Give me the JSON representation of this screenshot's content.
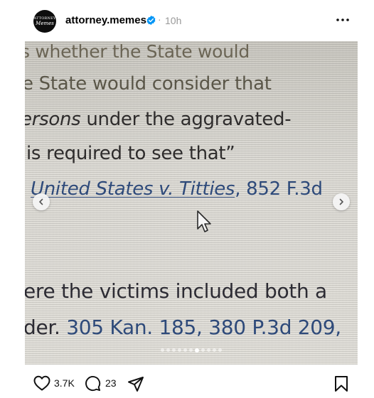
{
  "post": {
    "username": "attorney.memes",
    "separator": "·",
    "time": "10h",
    "avatar_top": "ATTORNEY",
    "avatar_bottom": "Memes"
  },
  "media": {
    "lines": {
      "l1": "s whether the State would",
      "l2": "e State would consider that",
      "l3_a": "ersons",
      "l3_b": " under the aggravated-",
      "l4": " is required to see that”",
      "l5_a": "United States v. Titties",
      "l5_b": ", 852 F.3d",
      "l6": "ere the victims included both a",
      "l7_a": "der. ",
      "l7_b": "305 Kan. 185, 380 P.3d 209,"
    },
    "carousel": {
      "total": 11,
      "active": 6
    }
  },
  "actions": {
    "likes": "3.7K",
    "comments": "23"
  },
  "colors": {
    "verified": "#0095f6",
    "citation": "#2e4a7a"
  },
  "icons": [
    "more-icon",
    "verified-badge-icon",
    "heart-icon",
    "comment-icon",
    "share-icon",
    "bookmark-icon",
    "chevron-left-icon",
    "chevron-right-icon",
    "cursor-icon"
  ]
}
